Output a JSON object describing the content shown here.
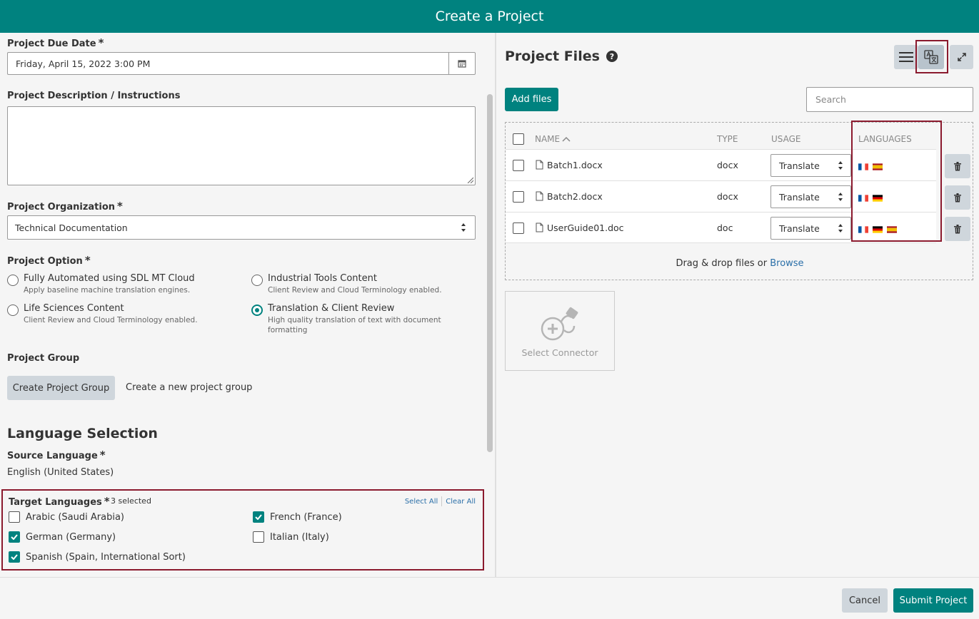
{
  "header": {
    "title": "Create a Project"
  },
  "form": {
    "due_date": {
      "label": "Project Due Date",
      "required": "*",
      "value": "Friday, April 15, 2022 3:00 PM"
    },
    "description": {
      "label": "Project Description / Instructions",
      "value": ""
    },
    "organization": {
      "label": "Project Organization",
      "required": "*",
      "value": "Technical Documentation"
    },
    "option": {
      "label": "Project Option",
      "required": "*",
      "items": [
        {
          "title": "Fully Automated using SDL MT Cloud",
          "desc": "Apply baseline machine translation engines.",
          "selected": false
        },
        {
          "title": "Industrial Tools Content",
          "desc": "Client Review and Cloud Terminology enabled.",
          "selected": false
        },
        {
          "title": "Life Sciences Content",
          "desc": "Client Review and Cloud Terminology enabled.",
          "selected": false
        },
        {
          "title": "Translation & Client Review",
          "desc": "High quality translation of text with document formatting",
          "selected": true
        }
      ]
    },
    "group": {
      "label": "Project Group",
      "button": "Create Project Group",
      "hint": "Create a new project group"
    }
  },
  "languages": {
    "section_title": "Language Selection",
    "source_label": "Source Language",
    "source_required": "*",
    "source_value": "English (United States)",
    "target_label": "Target Languages",
    "target_required": "*",
    "selected_count": "3 selected",
    "select_all": "Select All",
    "clear_all": "Clear All",
    "targets": [
      {
        "name": "Arabic (Saudi Arabia)",
        "checked": false
      },
      {
        "name": "French (France)",
        "checked": true
      },
      {
        "name": "German (Germany)",
        "checked": true
      },
      {
        "name": "Italian (Italy)",
        "checked": false
      },
      {
        "name": "Spanish (Spain, International Sort)",
        "checked": true
      }
    ]
  },
  "files": {
    "title": "Project Files",
    "help": "?",
    "add_button": "Add files",
    "search_placeholder": "Search",
    "columns": {
      "name": "NAME",
      "type": "TYPE",
      "usage": "USAGE",
      "languages": "LANGUAGES"
    },
    "rows": [
      {
        "name": "Batch1.docx",
        "type": "docx",
        "usage": "Translate",
        "flags": [
          "fr",
          "es"
        ]
      },
      {
        "name": "Batch2.docx",
        "type": "docx",
        "usage": "Translate",
        "flags": [
          "fr",
          "de"
        ]
      },
      {
        "name": "UserGuide01.doc",
        "type": "doc",
        "usage": "Translate",
        "flags": [
          "fr",
          "de",
          "es"
        ]
      }
    ],
    "drop_text": "Drag & drop files or",
    "browse": "Browse",
    "connector": "Select Connector",
    "icons": {
      "list": "list-view-icon",
      "language": "language-view-icon",
      "expand": "expand-icon"
    },
    "flag_colors": {
      "fr": [
        "#0055a4",
        "#ffffff",
        "#ef4135"
      ],
      "de": [
        "#000000",
        "#dd0000",
        "#ffce00"
      ],
      "es": [
        "#aa151b",
        "#f1bf00",
        "#aa151b"
      ]
    }
  },
  "footer": {
    "cancel": "Cancel",
    "submit": "Submit Project"
  },
  "colors": {
    "accent": "#00827f",
    "highlight": "#8b1a2e",
    "link": "#2a6fa8"
  }
}
